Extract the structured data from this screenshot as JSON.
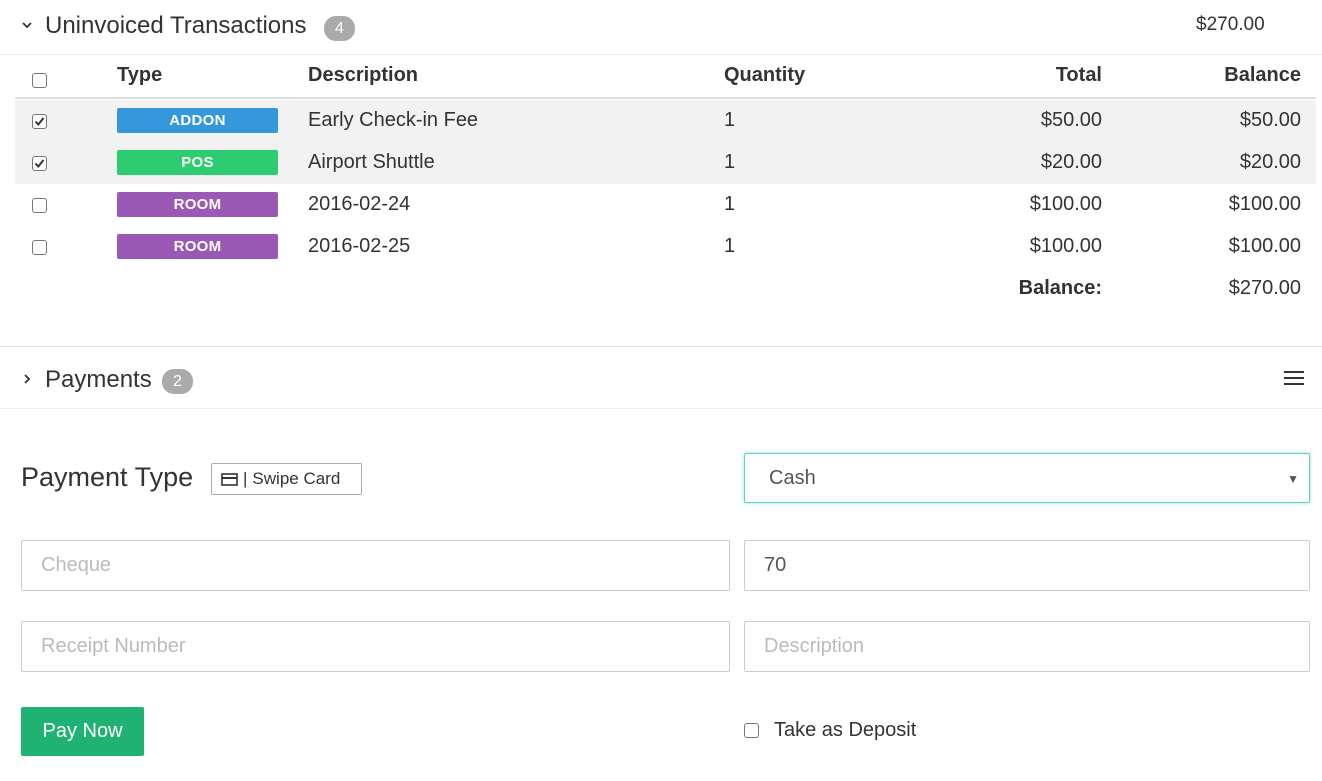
{
  "uninvoiced": {
    "title": "Uninvoiced Transactions",
    "count": "4",
    "total": "$270.00",
    "columns": {
      "type": "Type",
      "description": "Description",
      "quantity": "Quantity",
      "total": "Total",
      "balance": "Balance"
    },
    "rows": [
      {
        "checked": true,
        "tag": "ADDON",
        "tag_color": "#3498db",
        "description": "Early Check-in Fee",
        "quantity": "1",
        "total": "$50.00",
        "balance": "$50.00"
      },
      {
        "checked": true,
        "tag": "POS",
        "tag_color": "#2ecc71",
        "description": "Airport Shuttle",
        "quantity": "1",
        "total": "$20.00",
        "balance": "$20.00"
      },
      {
        "checked": false,
        "tag": "ROOM",
        "tag_color": "#9b59b6",
        "description": "2016-02-24",
        "quantity": "1",
        "total": "$100.00",
        "balance": "$100.00"
      },
      {
        "checked": false,
        "tag": "ROOM",
        "tag_color": "#9b59b6",
        "description": "2016-02-25",
        "quantity": "1",
        "total": "$100.00",
        "balance": "$100.00"
      }
    ],
    "balance_label": "Balance:",
    "balance_value": "$270.00"
  },
  "payments": {
    "title": "Payments",
    "count": "2",
    "menu_icon": "hamburger-menu-icon"
  },
  "form": {
    "payment_type_label": "Payment Type",
    "swipe_label": "Swipe Card",
    "payment_method_selected": "Cash",
    "cheque_placeholder": "Cheque",
    "amount_value": "70",
    "receipt_placeholder": "Receipt Number",
    "description_placeholder": "Description",
    "pay_button": "Pay Now",
    "deposit_label": "Take as Deposit"
  },
  "colors": {
    "pay_button": "#1fb272",
    "select_focus": "#5fd1c4",
    "badge": "#aaaaaa"
  }
}
